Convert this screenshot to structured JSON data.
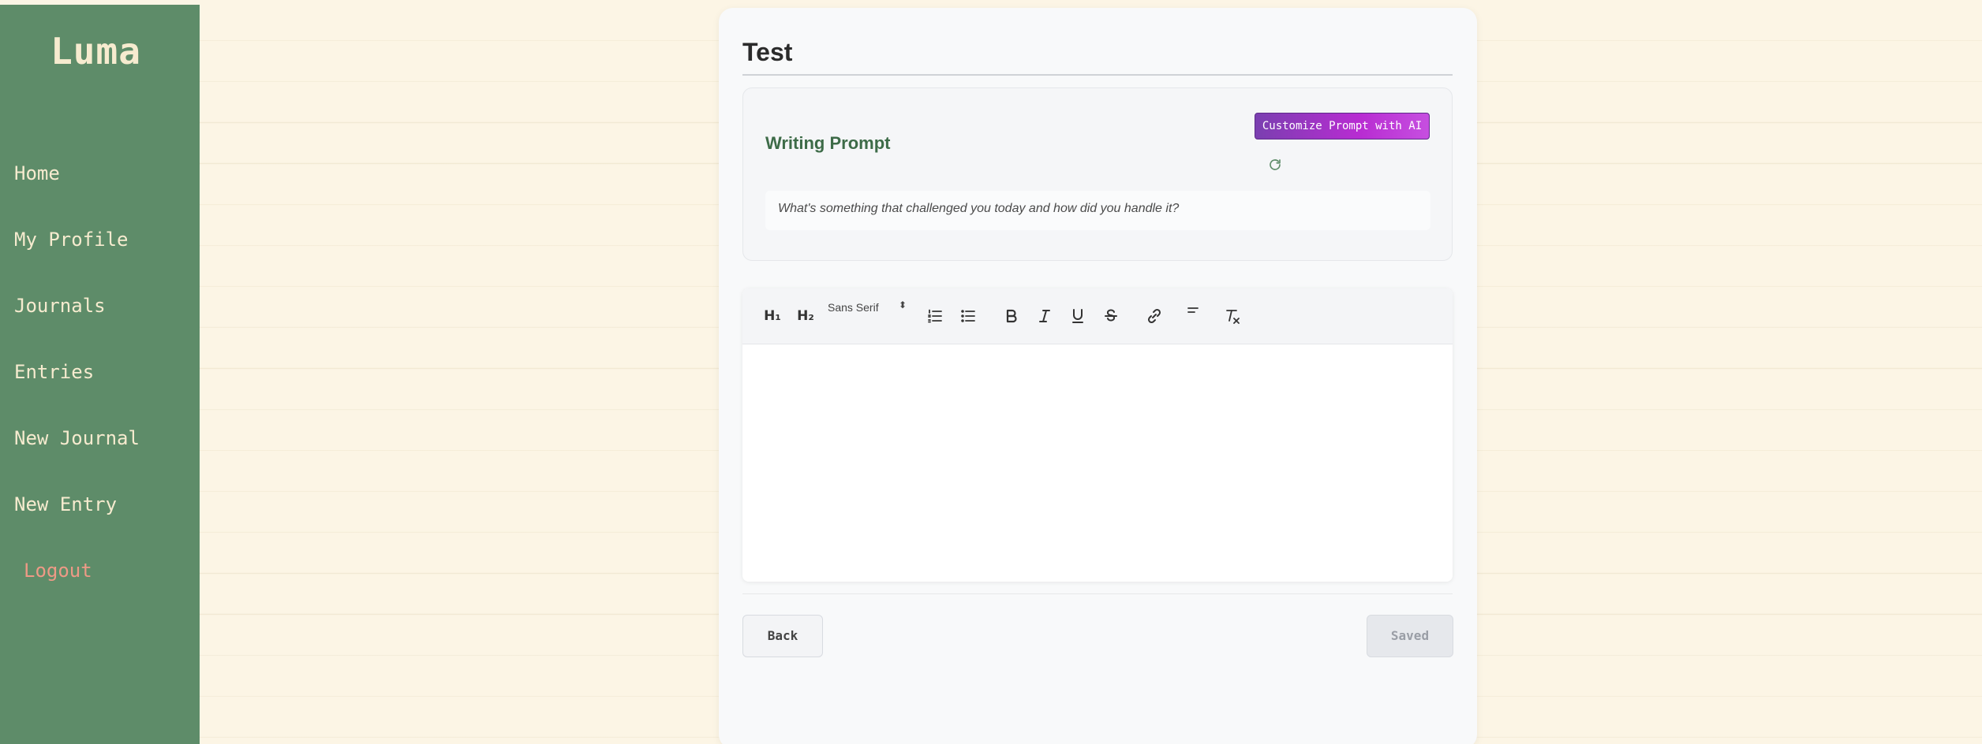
{
  "sidebar": {
    "brand": "Luma",
    "items": [
      {
        "label": "Home"
      },
      {
        "label": "My Profile"
      },
      {
        "label": "Journals"
      },
      {
        "label": "Entries"
      },
      {
        "label": "New Journal"
      },
      {
        "label": "New Entry"
      }
    ],
    "logout": "Logout"
  },
  "entry": {
    "title": "Test"
  },
  "prompt": {
    "label": "Writing Prompt",
    "customize_button": "Customize Prompt with AI",
    "refresh_icon": "refresh-icon",
    "text": "What's something that challenged you today and how did you handle it?"
  },
  "toolbar": {
    "h1": "H₁",
    "h2": "H₂",
    "font": "Sans Serif",
    "font_caret": "⬍",
    "icons": [
      "ordered-list-icon",
      "bullet-list-icon",
      "bold-icon",
      "italic-icon",
      "underline-icon",
      "strike-icon",
      "link-icon",
      "align-icon",
      "clear-format-icon"
    ]
  },
  "footer": {
    "back": "Back",
    "saved": "Saved"
  },
  "colors": {
    "page_bg": "#fcf5e5",
    "sidebar_bg": "#5e8c69",
    "brand_text": "#f6ebcf",
    "logout_text": "#ee9a86",
    "prompt_label": "#3d6b48",
    "ai_gradient_start": "#7a3fb0",
    "ai_gradient_end": "#c64fe0"
  }
}
